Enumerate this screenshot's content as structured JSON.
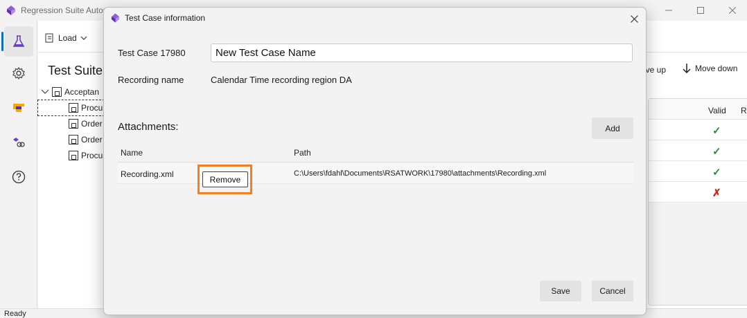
{
  "main_window": {
    "title": "Regression Suite Autor",
    "toolbar": {
      "load_label": "Load",
      "move_up_label": "ove up",
      "move_down_label": "Move down"
    },
    "suite_title": "Test Suite",
    "tree": {
      "root": "Acceptan",
      "children": [
        "Procu",
        "Order",
        "Order",
        "Procu"
      ]
    },
    "grid": {
      "headers": {
        "valid": "Valid",
        "result": "Result"
      },
      "rows": [
        {
          "valid": "✓"
        },
        {
          "valid": "✓"
        },
        {
          "valid": "✓"
        },
        {
          "valid": "✗"
        }
      ]
    },
    "status": "Ready",
    "colors": {
      "accent": "#0f6cbd",
      "valid_ok": "#2e8b3a",
      "valid_fail": "#c42b1c"
    }
  },
  "dialog": {
    "title": "Test Case information",
    "test_case_label": "Test Case 17980",
    "test_case_name": "New Test Case Name",
    "recording_label": "Recording name",
    "recording_value": "Calendar Time recording region DA",
    "attachments_label": "Attachments:",
    "add_label": "Add",
    "columns": {
      "name": "Name",
      "path": "Path"
    },
    "attachments": [
      {
        "name": "Recording.xml",
        "remove_label": "Remove",
        "path": "C:\\Users\\fdahl\\Documents\\RSATWORK\\17980\\attachments\\Recording.xml"
      }
    ],
    "save_label": "Save",
    "cancel_label": "Cancel",
    "highlight_color": "#f08020"
  }
}
